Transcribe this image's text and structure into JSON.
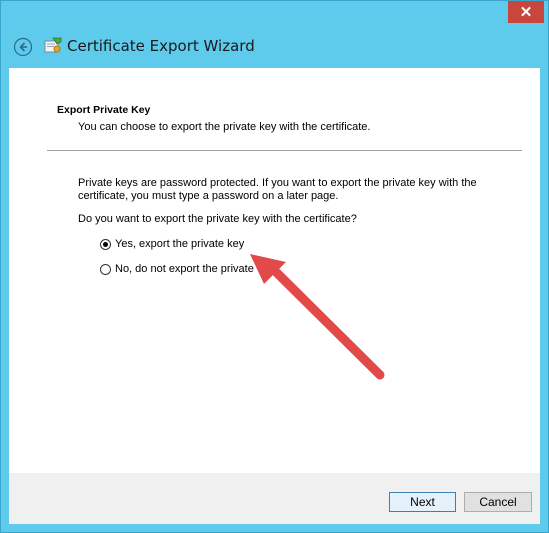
{
  "window": {
    "title": "Certificate Export Wizard",
    "close_glyph": "✕"
  },
  "page": {
    "heading": "Export Private Key",
    "description": "You can choose to export the private key with the certificate.",
    "info": "Private keys are password protected. If you want to export the private key with the certificate, you must type a password on a later page.",
    "question": "Do you want to export the private key with the certificate?",
    "options": [
      {
        "label": "Yes, export the private key",
        "checked": true
      },
      {
        "label": "No, do not export the private",
        "checked": false
      }
    ]
  },
  "footer": {
    "next_label": "Next",
    "cancel_label": "Cancel"
  },
  "annotation": {
    "color": "#e24a4a"
  }
}
